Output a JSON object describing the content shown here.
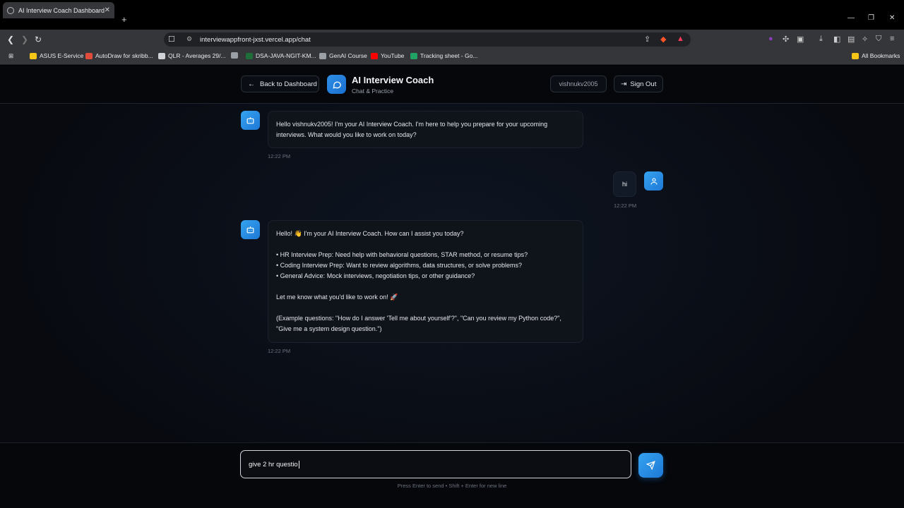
{
  "browser": {
    "tab_title": "AI Interview Coach Dashboard",
    "url": "interviewappfront-jxst.vercel.app/chat",
    "bookmarks": [
      {
        "label": "ASUS E-Service",
        "color": "#f5c518"
      },
      {
        "label": "AutoDraw for skribb...",
        "color": "#e04b3c"
      },
      {
        "label": "QLR - Averages 29/...",
        "color": "#cfd3d8"
      },
      {
        "label": "",
        "color": "#9aa0a6"
      },
      {
        "label": "DSA-JAVA-NGIT-KM...",
        "color": "#1f6e3a"
      },
      {
        "label": "GenAI Course",
        "color": "#9aa0a6"
      },
      {
        "label": "YouTube",
        "color": "#ff0000"
      },
      {
        "label": "Tracking sheet - Go...",
        "color": "#21a366"
      }
    ],
    "all_bookmarks": "All Bookmarks"
  },
  "header": {
    "back_label": "Back to Dashboard",
    "title": "AI Interview Coach",
    "subtitle": "Chat & Practice",
    "username": "vishnukv2005",
    "signout_label": "Sign Out"
  },
  "messages": [
    {
      "sender": "bot",
      "lines": [
        "Hello vishnukv2005! I'm your AI Interview Coach. I'm here to help you prepare for your upcoming",
        "interviews. What would you like to work on today?"
      ],
      "time": "12:22 PM"
    },
    {
      "sender": "user",
      "text": "hi",
      "time": "12:22 PM"
    },
    {
      "sender": "bot",
      "lines": [
        "Hello! 👋 I'm your AI Interview Coach. How can I assist you today?",
        "",
        "• HR Interview Prep: Need help with behavioral questions, STAR method, or resume tips?",
        "• Coding Interview Prep: Want to review algorithms, data structures, or solve problems?",
        "• General Advice: Mock interviews, negotiation tips, or other guidance?",
        "",
        "Let me know what you'd like to work on! 🚀",
        "",
        "(Example questions: \"How do I answer 'Tell me about yourself'?\", \"Can you review my Python code?\",",
        "\"Give me a system design question.\")"
      ],
      "time": "12:22 PM"
    }
  ],
  "composer": {
    "value": "give 2 hr questio",
    "hint": "Press Enter to send • Shift + Enter for new line"
  },
  "colors": {
    "accent": "#2f8fe6",
    "background": "#080a10"
  }
}
